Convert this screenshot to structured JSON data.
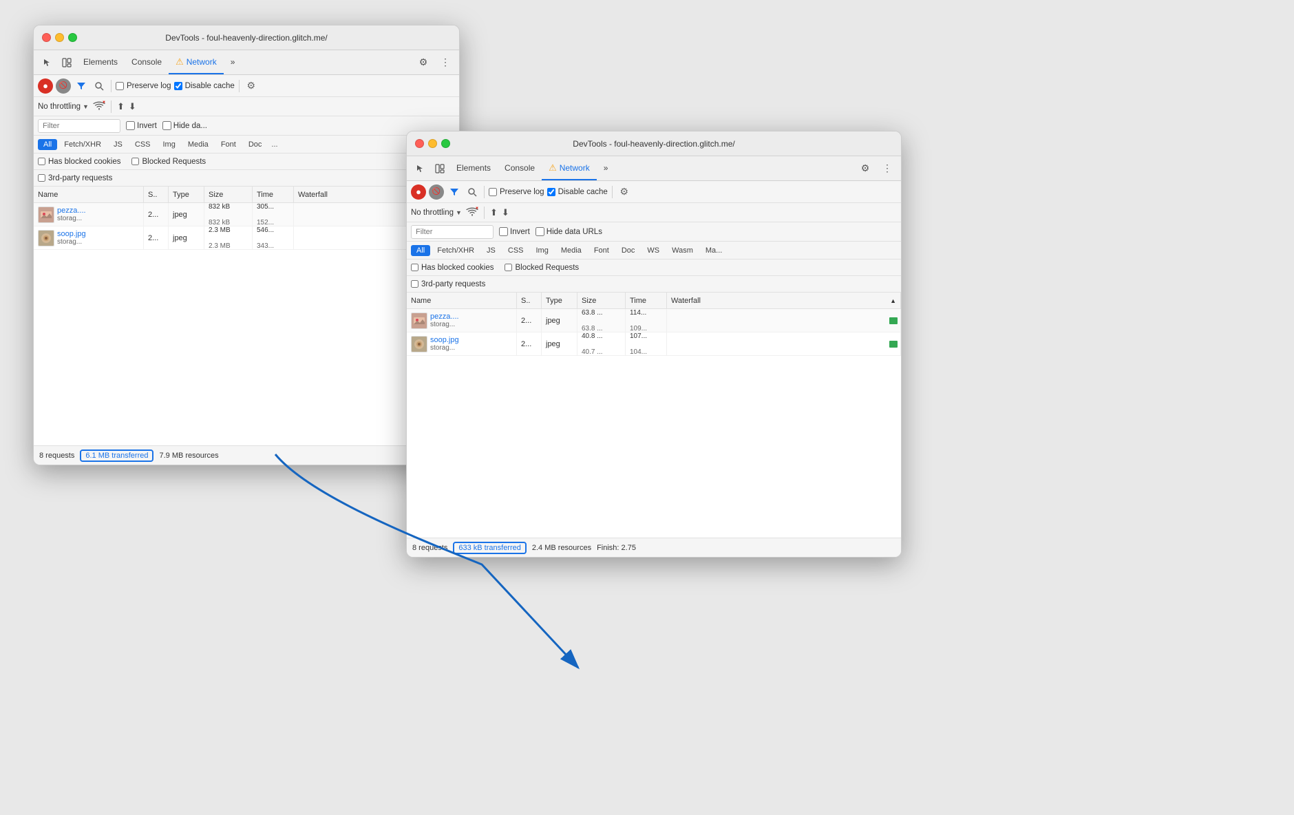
{
  "title_bar": {
    "title": "DevTools - foul-heavenly-direction.glitch.me/"
  },
  "window_back": {
    "title": "DevTools - foul-heavenly-direction.glitch.me/",
    "tabs": {
      "elements": "Elements",
      "console": "Console",
      "network": "Network",
      "more": "»",
      "settings_icon": "⚙",
      "more_vert": "⋮"
    },
    "toolbar": {
      "preserve_log": "Preserve log",
      "disable_cache": "Disable cache"
    },
    "throttle": {
      "label": "No throttling",
      "dropdown": "▼"
    },
    "filter": {
      "placeholder": "Filter",
      "invert": "Invert",
      "hide_data": "Hide da..."
    },
    "resource_types": [
      "All",
      "Fetch/XHR",
      "JS",
      "CSS",
      "Img",
      "Media",
      "Font",
      "Doc"
    ],
    "checkboxes": {
      "has_blocked_cookies": "Has blocked cookies",
      "blocked_requests": "Blocked Requests",
      "third_party": "3rd-party requests"
    },
    "table_headers": {
      "name": "Name",
      "status": "S..",
      "type": "Type",
      "size": "Size",
      "time": "Time",
      "waterfall": "Waterfall"
    },
    "rows": [
      {
        "name_main": "pezza....",
        "name_sub": "storag...",
        "status": "2...",
        "type": "jpeg",
        "size_main": "832 kB",
        "size_sub": "832 kB",
        "time_main": "305...",
        "time_sub": "152..."
      },
      {
        "name_main": "soop.jpg",
        "name_sub": "storag...",
        "status": "2...",
        "type": "jpeg",
        "size_main": "2.3 MB",
        "size_sub": "2.3 MB",
        "time_main": "546...",
        "time_sub": "343..."
      }
    ],
    "status_bar": {
      "requests": "8 requests",
      "transferred": "6.1 MB transferred",
      "resources": "7.9 MB resources"
    }
  },
  "window_front": {
    "title": "DevTools - foul-heavenly-direction.glitch.me/",
    "tabs": {
      "elements": "Elements",
      "console": "Console",
      "network": "Network",
      "more": "»",
      "settings_icon": "⚙",
      "more_vert": "⋮"
    },
    "toolbar": {
      "preserve_log": "Preserve log",
      "disable_cache": "Disable cache"
    },
    "throttle": {
      "label": "No throttling",
      "dropdown": "▼"
    },
    "filter": {
      "placeholder": "Filter",
      "invert": "Invert",
      "hide_data_urls": "Hide data URLs"
    },
    "resource_types": [
      "All",
      "Fetch/XHR",
      "JS",
      "CSS",
      "Img",
      "Media",
      "Font",
      "Doc",
      "WS",
      "Wasm",
      "Ma..."
    ],
    "checkboxes": {
      "has_blocked_cookies": "Has blocked cookies",
      "blocked_requests": "Blocked Requests",
      "third_party": "3rd-party requests"
    },
    "table_headers": {
      "name": "Name",
      "status": "S..",
      "type": "Type",
      "size": "Size",
      "time": "Time",
      "waterfall": "Waterfall"
    },
    "rows": [
      {
        "name_main": "pezza....",
        "name_sub": "storag...",
        "status": "2...",
        "type": "jpeg",
        "size_main": "63.8 ...",
        "size_sub": "63.8 ...",
        "time_main": "114...",
        "time_sub": "109..."
      },
      {
        "name_main": "soop.jpg",
        "name_sub": "storag...",
        "status": "2...",
        "type": "jpeg",
        "size_main": "40.8 ...",
        "size_sub": "40.7 ...",
        "time_main": "107...",
        "time_sub": "104..."
      }
    ],
    "status_bar": {
      "requests": "8 requests",
      "transferred": "633 kB transferred",
      "resources": "2.4 MB resources",
      "finish": "Finish: 2.75"
    }
  },
  "colors": {
    "accent": "#1a73e8",
    "warning": "#f5a623",
    "record_red": "#d93025",
    "green": "#34a853",
    "highlight_border": "#1565c0"
  }
}
